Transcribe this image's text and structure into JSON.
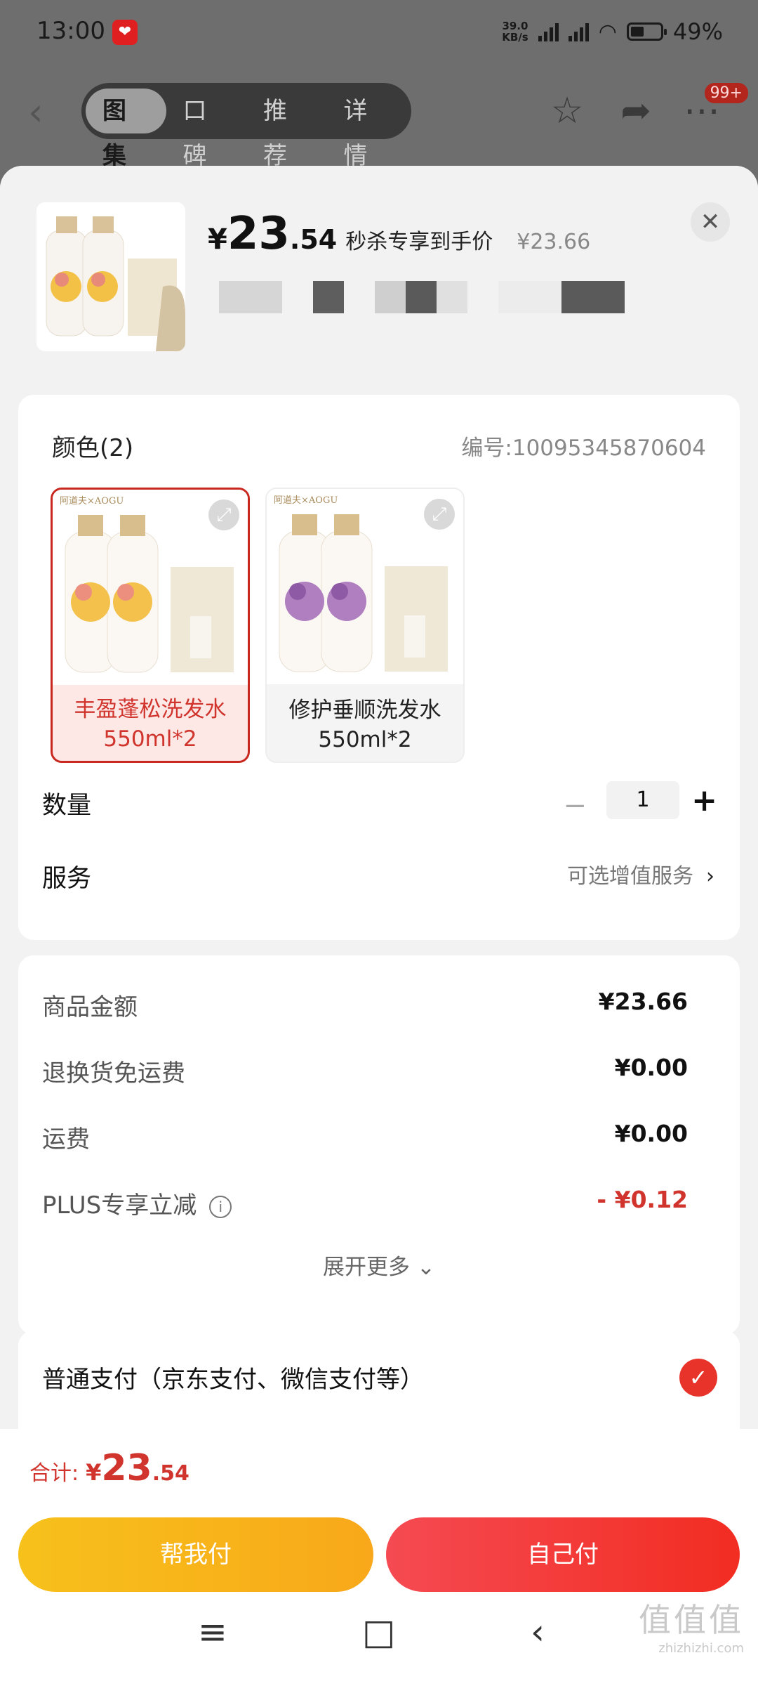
{
  "status_bar": {
    "time": "13:00",
    "net_speed_top": "39.0",
    "net_speed_bottom": "KB/s",
    "battery": "49%"
  },
  "nav": {
    "tabs": [
      {
        "label": "图集",
        "active": true
      },
      {
        "label": "口碑",
        "active": false
      },
      {
        "label": "推荐",
        "active": false
      },
      {
        "label": "详情",
        "active": false
      }
    ],
    "cart_badge": "99+"
  },
  "product": {
    "price_currency": "¥",
    "price_int": "23",
    "price_dec": ".54",
    "price_tag": "秒杀专享到手价",
    "original_price": "¥23.66"
  },
  "options": {
    "title": "颜色(2)",
    "sku": "编号:10095345870604",
    "items": [
      {
        "name": "丰盈蓬松洗发水\n550ml*2",
        "line1": "丰盈蓬松洗发水",
        "line2": "550ml*2",
        "selected": true
      },
      {
        "name": "修护垂顺洗发水\n550ml*2",
        "line1": "修护垂顺洗发水",
        "line2": "550ml*2",
        "selected": false
      }
    ]
  },
  "quantity": {
    "label": "数量",
    "value": "1",
    "minus": "−",
    "plus": "+"
  },
  "service": {
    "label": "服务",
    "link": "可选增值服务"
  },
  "fees": [
    {
      "label": "商品金额",
      "value": "¥23.66"
    },
    {
      "label": "退换货免运费",
      "value": "¥0.00"
    },
    {
      "label": "运费",
      "value": "¥0.00"
    },
    {
      "label": "PLUS专享立减",
      "value": "- ¥0.12"
    }
  ],
  "more": "展开更多",
  "payment": {
    "label": "普通支付（京东支付、微信支付等）"
  },
  "bottom": {
    "total_label": "合计:",
    "total_cur": "¥",
    "total_int": "23",
    "total_dec": ".54",
    "help_pay": "帮我付",
    "self_pay": "自己付"
  },
  "watermark": {
    "big": "值值值",
    "small": "zhizhizhi.com"
  },
  "colors": {
    "accent_red": "#d0342c",
    "pay_red": "#f22d22",
    "help_yellow": "#f7b81b"
  }
}
